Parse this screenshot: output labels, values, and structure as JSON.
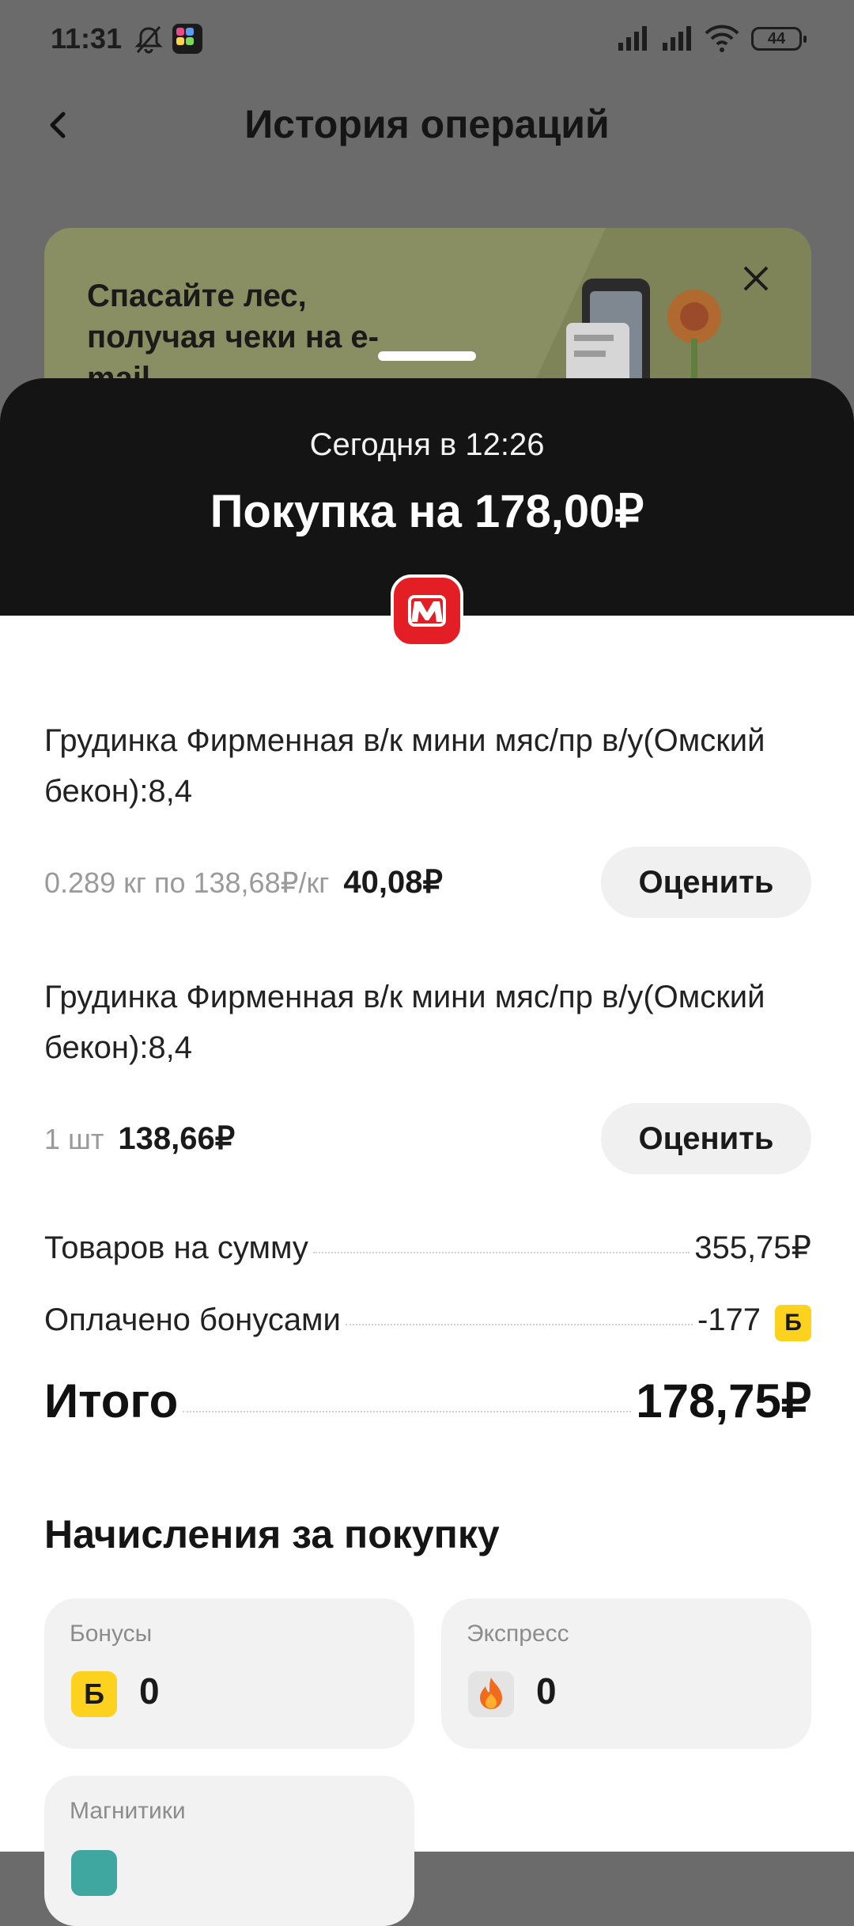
{
  "status": {
    "time": "11:31",
    "battery": "44"
  },
  "header": {
    "title": "История операций"
  },
  "promo": {
    "text": "Спасайте лес, получая чеки на e-mail"
  },
  "purchase": {
    "date": "Сегодня в 12:26",
    "title": "Покупка на 178,00₽"
  },
  "items": [
    {
      "name": "Грудинка Фирменная в/к мини мяс/пр в/у(Омский бекон):8,4",
      "meta": "0.289 кг по 138,68₽/кг",
      "price": "40,08₽",
      "button": "Оценить"
    },
    {
      "name": "Грудинка Фирменная в/к мини мяс/пр в/у(Омский бекон):8,4",
      "meta": "1 шт",
      "price": "138,66₽",
      "button": "Оценить"
    }
  ],
  "summary": {
    "goods_label": "Товаров на сумму",
    "goods_value": "355,75₽",
    "bonus_label": "Оплачено бонусами",
    "bonus_value": "-177",
    "bonus_badge": "Б",
    "total_label": "Итого",
    "total_value": "178,75₽"
  },
  "accruals": {
    "title": "Начисления за покупку",
    "cards": [
      {
        "title": "Бонусы",
        "icon": "Б",
        "value": "0"
      },
      {
        "title": "Экспресс",
        "value": "0"
      },
      {
        "title": "Магнитики"
      }
    ]
  },
  "colors": {
    "brand_red": "#e31e24",
    "bonus_yellow": "#fcd21f",
    "sheet_dark": "#141414"
  }
}
